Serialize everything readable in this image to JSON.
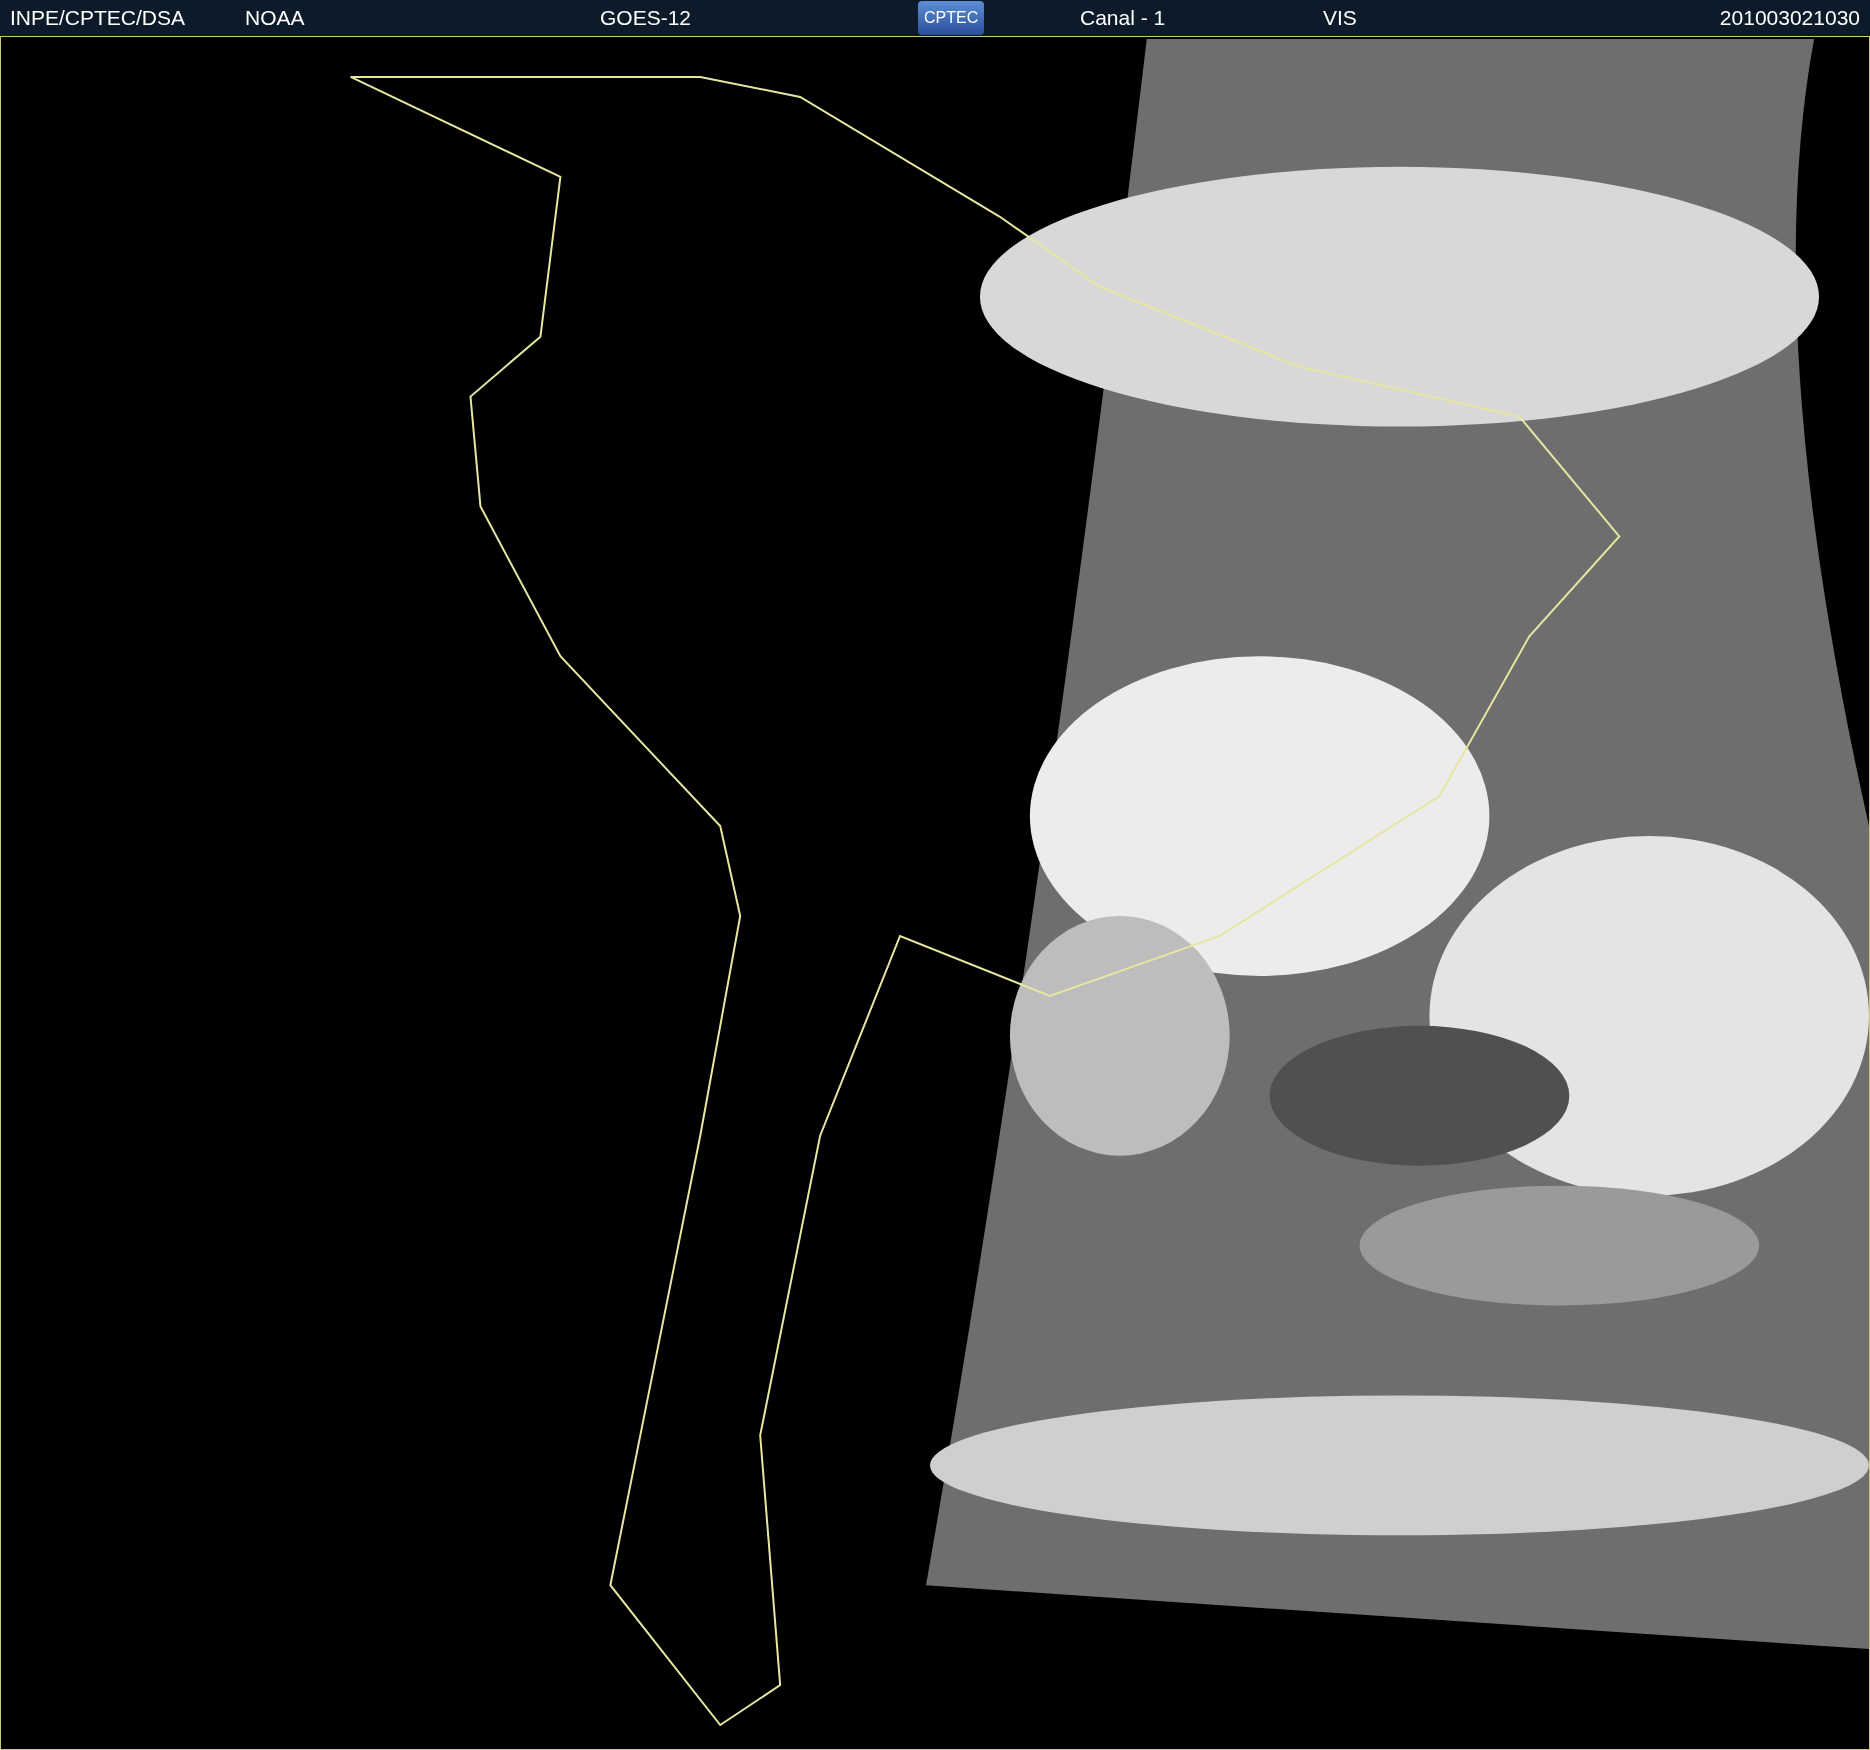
{
  "header": {
    "items": [
      {
        "kind": "text",
        "text": "INPE/CPTEC/DSA"
      },
      {
        "kind": "text",
        "text": "NOAA"
      },
      {
        "kind": "text",
        "text": "GOES-12"
      },
      {
        "kind": "logo",
        "text": "CPTEC"
      },
      {
        "kind": "text",
        "text": "Canal - 1"
      },
      {
        "kind": "text",
        "text": "VIS"
      },
      {
        "kind": "text",
        "text": "201003021030"
      }
    ]
  }
}
